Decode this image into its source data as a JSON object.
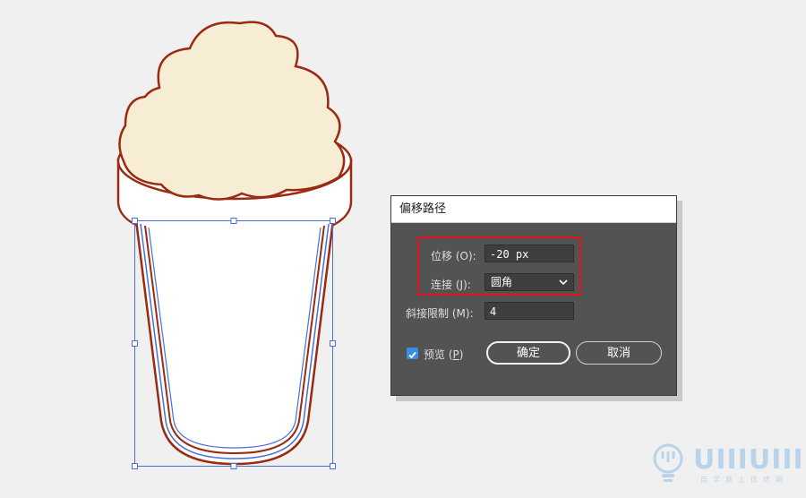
{
  "dialog": {
    "title": "偏移路径",
    "offset": {
      "label": "位移",
      "hotkey": "(O)",
      "colon": ":",
      "value": "-20 px"
    },
    "joins": {
      "label": "连接",
      "hotkey": "(J)",
      "colon": ":",
      "value": "圆角"
    },
    "miter_limit": {
      "label": "斜接限制",
      "hotkey": "(M)",
      "colon": ":",
      "value": "4"
    },
    "preview": {
      "label": "预览",
      "hotkey": "P",
      "checked": true
    },
    "ok_label": "确定",
    "cancel_label": "取消",
    "highlight_color": "#e0141e"
  },
  "artwork": {
    "cream_fill": "#f7edd5",
    "outline_color": "#9a2a10",
    "selection_color": "#4a6fd8"
  },
  "watermark": {
    "text": "UIIIUIII",
    "subtitle": "自学就上优优网"
  }
}
